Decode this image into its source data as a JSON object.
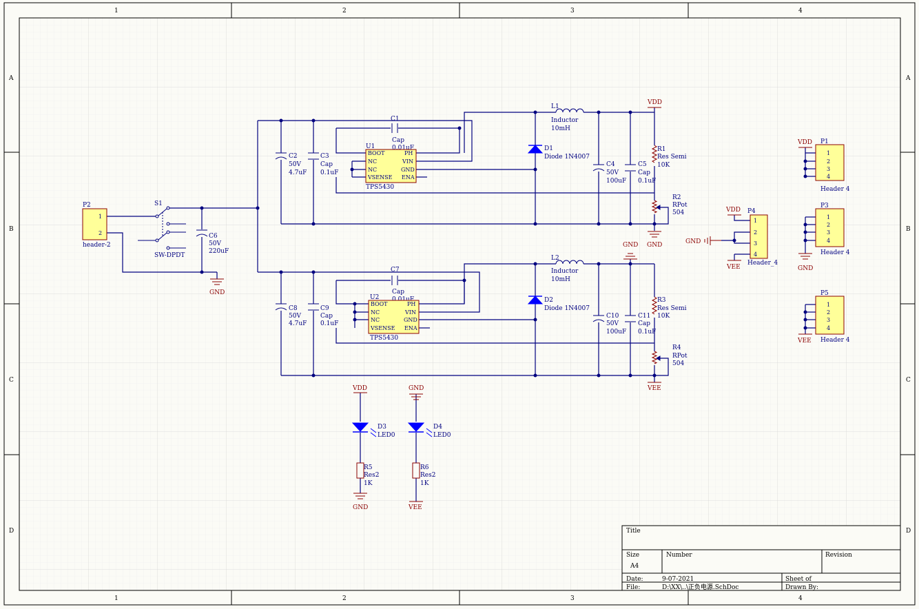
{
  "frame": {
    "columns": [
      "1",
      "2",
      "3",
      "4"
    ],
    "rows": [
      "A",
      "B",
      "C",
      "D"
    ]
  },
  "colors": {
    "background": "#ffffff",
    "sheet": "#fbfbf6",
    "grid": "#d9d9d9",
    "wire": "#00007f",
    "component_fill": "#ffff99",
    "component_stroke": "#8b0000",
    "power_label": "#8b0000",
    "diode_fill": "#0000ff"
  },
  "labels": {
    "p2": "P2",
    "p2_pin1": "1",
    "p2_pin2": "2",
    "p2_name": "header-2",
    "s1": "S1",
    "s1_name": "SW-DPDT",
    "c6": "C6",
    "c6_v": "50V",
    "c6_val": "220uF",
    "gnd_main": "GND",
    "c2": "C2",
    "c2_v": "50V",
    "c2_val": "4.7uF",
    "c3": "C3",
    "c3_type": "Cap",
    "c3_val": "0.1uF",
    "c1": "C1",
    "c1_type": "Cap",
    "c1_val": "0.01uF",
    "u1": "U1",
    "u1_name": "TPS5430",
    "u1_boot": "BOOT",
    "u1_nc1": "NC",
    "u1_nc2": "NC",
    "u1_vsense": "VSENSE",
    "u1_ph": "PH",
    "u1_vin": "VIN",
    "u1_gnd": "GND",
    "u1_ena": "ENA",
    "l1": "L1",
    "l1_type": "Inductor",
    "l1_val": "10mH",
    "d1": "D1",
    "d1_name": "Diode 1N4007",
    "c4": "C4",
    "c4_v": "50V",
    "c4_val": "100uF",
    "c5": "C5",
    "c5_type": "Cap",
    "c5_val": "0.1uF",
    "vdd_top": "VDD",
    "r1": "R1",
    "r1_type": "Res Semi",
    "r1_val": "10K",
    "r2": "R2",
    "r2_type": "RPot",
    "r2_val": "504",
    "gnd_r2": "GND",
    "c8": "C8",
    "c8_v": "50V",
    "c8_val": "4.7uF",
    "c9": "C9",
    "c9_type": "Cap",
    "c9_val": "0.1uF",
    "c7": "C7",
    "c7_type": "Cap",
    "c7_val": "0.01uF",
    "u2": "U2",
    "u2_name": "TPS5430",
    "u2_boot": "BOOT",
    "u2_nc1": "NC",
    "u2_nc2": "NC",
    "u2_vsense": "VSENSE",
    "u2_ph": "PH",
    "u2_vin": "VIN",
    "u2_gnd": "GND",
    "u2_ena": "ENA",
    "l2": "L2",
    "l2_type": "Inductor",
    "l2_val": "10mH",
    "d2": "D2",
    "d2_name": "Diode 1N4007",
    "c10": "C10",
    "c10_v": "50V",
    "c10_val": "100uF",
    "c11": "C11",
    "c11_type": "Cap",
    "c11_val": "0.1uF",
    "gnd_l2": "GND",
    "r3": "R3",
    "r3_type": "Res Semi",
    "r3_val": "10K",
    "r4": "R4",
    "r4_type": "RPot",
    "r4_val": "504",
    "vee_r4": "VEE",
    "vdd_d3": "VDD",
    "d3": "D3",
    "d3_name": "LED0",
    "r5": "R5",
    "r5_type": "Res2",
    "r5_val": "1K",
    "gnd_r5": "GND",
    "gnd_d4": "GND",
    "d4": "D4",
    "d4_name": "LED0",
    "r6": "R6",
    "r6_type": "Res2",
    "r6_val": "1K",
    "vee_r6": "VEE",
    "p1": "P1",
    "p1_name": "Header 4",
    "vdd_p1": "VDD",
    "p3": "P3",
    "p3_name": "Header 4",
    "gnd_p3": "GND",
    "p4": "P4",
    "p4_name": "Header_4",
    "vdd_p4": "VDD",
    "gnd_p4": "GND",
    "vee_p4": "VEE",
    "p5": "P5",
    "p5_name": "Header 4",
    "vee_p5": "VEE",
    "pin1": "1",
    "pin2": "2",
    "pin3": "3",
    "pin4": "4"
  },
  "title_block": {
    "title_label": "Title",
    "size_label": "Size",
    "size_value": "A4",
    "number_label": "Number",
    "revision_label": "Revision",
    "date_label": "Date:",
    "date_value": "9-07-2021",
    "sheet_label": "Sheet   of",
    "file_label": "File:",
    "file_value": "D:\\XX\\..\\正负电源.SchDoc",
    "drawn_label": "Drawn By:"
  }
}
